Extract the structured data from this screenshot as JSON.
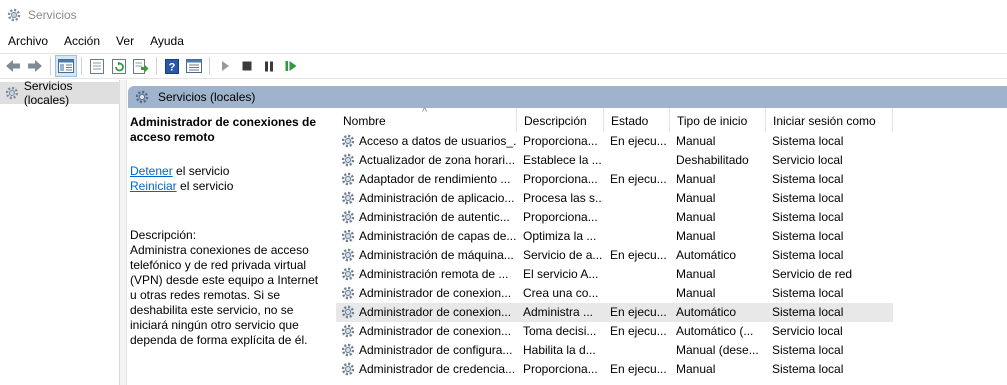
{
  "window": {
    "title": "Servicios"
  },
  "menu": [
    "Archivo",
    "Acción",
    "Ver",
    "Ayuda"
  ],
  "toolbar": [
    "back-arrow-icon",
    "forward-arrow-icon",
    "console-tree-icon",
    "properties-icon",
    "refresh-icon",
    "export-list-icon",
    "help-icon",
    "details-view-icon",
    "start-icon",
    "stop-icon",
    "pause-icon",
    "restart-icon"
  ],
  "tree": {
    "item": "Servicios (locales)"
  },
  "pane": {
    "header": "Servicios (locales)"
  },
  "details": {
    "title": "Administrador de conexiones de acceso remoto",
    "stop_link": "Detener",
    "stop_suffix": " el servicio",
    "restart_link": "Reiniciar",
    "restart_suffix": " el servicio",
    "desc_label": "Descripción:",
    "description": "Administra conexiones de acceso telefónico y de red privada virtual (VPN) desde este equipo a Internet u otras redes remotas. Si se deshabilita este servicio, no se iniciará ningún otro servicio que dependa de forma explícita de él."
  },
  "columns": [
    "Nombre",
    "Descripción",
    "Estado",
    "Tipo de inicio",
    "Iniciar sesión como"
  ],
  "services": [
    {
      "name": "Acceso a datos de usuarios_...",
      "desc": "Proporciona...",
      "state": "En ejecu...",
      "start": "Manual",
      "logon": "Sistema local",
      "selected": false
    },
    {
      "name": "Actualizador de zona horari...",
      "desc": "Establece la ...",
      "state": "",
      "start": "Deshabilitado",
      "logon": "Servicio local",
      "selected": false
    },
    {
      "name": "Adaptador de rendimiento ...",
      "desc": "Proporciona...",
      "state": "En ejecu...",
      "start": "Manual",
      "logon": "Sistema local",
      "selected": false
    },
    {
      "name": "Administración de aplicacio...",
      "desc": "Procesa las s...",
      "state": "",
      "start": "Manual",
      "logon": "Sistema local",
      "selected": false
    },
    {
      "name": "Administración de autentic...",
      "desc": "Proporciona...",
      "state": "",
      "start": "Manual",
      "logon": "Sistema local",
      "selected": false
    },
    {
      "name": "Administración de capas de...",
      "desc": "Optimiza la ...",
      "state": "",
      "start": "Manual",
      "logon": "Sistema local",
      "selected": false
    },
    {
      "name": "Administración de máquina...",
      "desc": "Servicio de a...",
      "state": "En ejecu...",
      "start": "Automático",
      "logon": "Sistema local",
      "selected": false
    },
    {
      "name": "Administración remota de ...",
      "desc": "El servicio A...",
      "state": "",
      "start": "Manual",
      "logon": "Servicio de red",
      "selected": false
    },
    {
      "name": "Administrador de conexion...",
      "desc": "Crea una co...",
      "state": "",
      "start": "Manual",
      "logon": "Sistema local",
      "selected": false
    },
    {
      "name": "Administrador de conexion...",
      "desc": "Administra ...",
      "state": "En ejecu...",
      "start": "Automático",
      "logon": "Sistema local",
      "selected": true
    },
    {
      "name": "Administrador de conexion...",
      "desc": "Toma decisi...",
      "state": "En ejecu...",
      "start": "Automático (...",
      "logon": "Servicio local",
      "selected": false
    },
    {
      "name": "Administrador de configura...",
      "desc": "Habilita la d...",
      "state": "",
      "start": "Manual (dese...",
      "logon": "Sistema local",
      "selected": false
    },
    {
      "name": "Administrador de credencia...",
      "desc": "Proporciona...",
      "state": "En ejecu...",
      "start": "Manual",
      "logon": "Sistema local",
      "selected": false
    }
  ]
}
